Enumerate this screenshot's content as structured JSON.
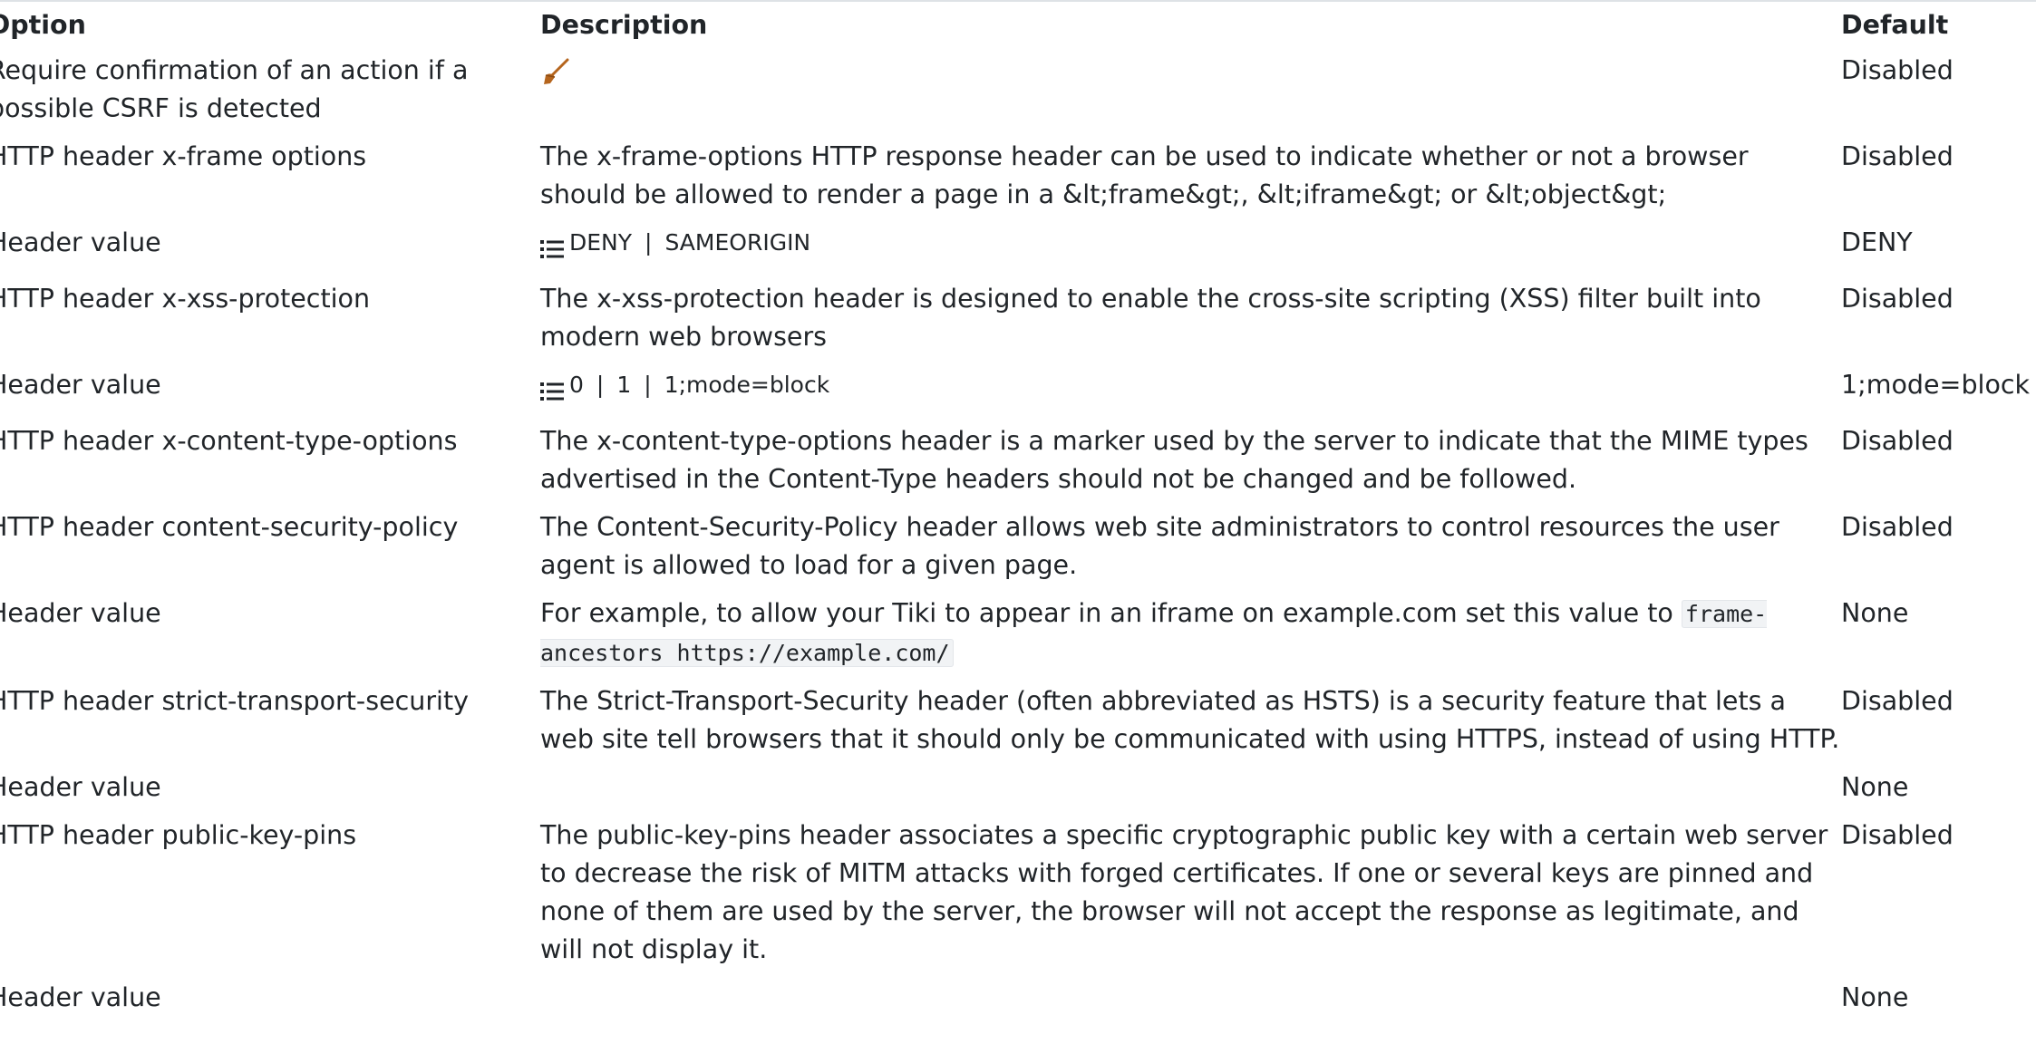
{
  "headers": {
    "option": "Option",
    "description": "Description",
    "default": "Default"
  },
  "icons": {
    "broom": "broom-icon",
    "list": "list-icon",
    "broom_color": "#b5651d"
  },
  "rows": [
    {
      "option": "Require confirmation of an action if a possible CSRF is detected",
      "description": "",
      "has_broom": true,
      "default": "Disabled"
    },
    {
      "option": "HTTP header x-frame options",
      "description": "The x-frame-options HTTP response header can be used to indicate whether or not a browser should be allowed to render a page in a &lt;frame&gt;, &lt;iframe&gt; or &lt;object&gt;",
      "default": "Disabled"
    },
    {
      "option": "Header value",
      "options_list": [
        "DENY",
        "SAMEORIGIN"
      ],
      "default": "DENY"
    },
    {
      "option": "HTTP header x-xss-protection",
      "description": "The x-xss-protection header is designed to enable the cross-site scripting (XSS) filter built into modern web browsers",
      "default": "Disabled"
    },
    {
      "option": "Header value",
      "options_list": [
        "0",
        "1",
        "1;mode=block"
      ],
      "default": "1;mode=block"
    },
    {
      "option": "HTTP header x-content-type-options",
      "description": "The x-content-type-options header is a marker used by the server to indicate that the MIME types advertised in the Content-Type headers should not be changed and be followed.",
      "default": "Disabled"
    },
    {
      "option": "HTTP header content-security-policy",
      "description": "The Content-Security-Policy header allows web site administrators to control resources the user agent is allowed to load for a given page.",
      "default": "Disabled"
    },
    {
      "option": "Header value",
      "description": "For example, to allow your Tiki to appear in an iframe on example.com set this value to",
      "code": "frame-ancestors https://example.com/",
      "default": "None"
    },
    {
      "option": "HTTP header strict-transport-security",
      "description": "The Strict-Transport-Security header (often abbreviated as HSTS) is a security feature that lets a web site tell browsers that it should only be communicated with using HTTPS, instead of using HTTP.",
      "default": "Disabled"
    },
    {
      "option": "Header value",
      "description": "",
      "default": "None"
    },
    {
      "option": "HTTP header public-key-pins",
      "description": "The public-key-pins header associates a specific cryptographic public key with a certain web server to decrease the risk of MITM attacks with forged certificates. If one or several keys are pinned and none of them are used by the server, the browser will not accept the response as legitimate, and will not display it.",
      "default": "Disabled"
    },
    {
      "option": "Header value",
      "description": "",
      "default": "None"
    }
  ]
}
